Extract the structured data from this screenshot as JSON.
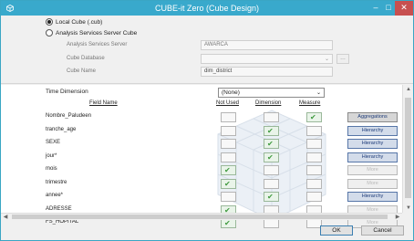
{
  "window": {
    "title": "CUBE-it Zero (Cube Design)",
    "minimize_glyph": "–",
    "maximize_glyph": "□",
    "close_glyph": "✕"
  },
  "source": {
    "local_cube_label": "Local Cube (.cub)",
    "analysis_services_label": "Analysis Services Server Cube",
    "selected": "local"
  },
  "properties": {
    "server_label": "Analysis Services Server",
    "server_value": "AWARCA",
    "database_label": "Cube Database",
    "database_value": "",
    "browse_label": "…",
    "cube_name_label": "Cube Name",
    "cube_name_value": "dim_district"
  },
  "time_dimension": {
    "label": "Time Dimension",
    "value": "(None)"
  },
  "columns": {
    "field_name": "Field Name",
    "not_used": "Not Used",
    "dimension": "Dimension",
    "measure": "Measure"
  },
  "fields": [
    {
      "name": "Nombre_Paludeen",
      "choice": "measure",
      "action": "Aggregations",
      "action_state": "agg"
    },
    {
      "name": "tranche_age",
      "choice": "dimension",
      "action": "Hierarchy",
      "action_state": "active"
    },
    {
      "name": "SEXE",
      "choice": "dimension",
      "action": "Hierarchy",
      "action_state": "active"
    },
    {
      "name": "jour*",
      "choice": "dimension",
      "action": "Hierarchy",
      "action_state": "active"
    },
    {
      "name": "mois",
      "choice": "not_used",
      "action": "More",
      "action_state": "disabled"
    },
    {
      "name": "trimestre",
      "choice": "not_used",
      "action": "More",
      "action_state": "disabled"
    },
    {
      "name": "annee*",
      "choice": "dimension",
      "action": "Hierarchy",
      "action_state": "active"
    },
    {
      "name": "ADRESSE",
      "choice": "not_used",
      "action": "More",
      "action_state": "disabled"
    },
    {
      "name": "FS_HOPITAL",
      "choice": "not_used",
      "action": "More",
      "action_state": "disabled"
    }
  ],
  "buttons": {
    "ok": "OK",
    "cancel": "Cancel"
  },
  "colors": {
    "titlebar": "#39a9cc",
    "check": "#3f9a3f",
    "hierarchy": "#1c3a78"
  }
}
